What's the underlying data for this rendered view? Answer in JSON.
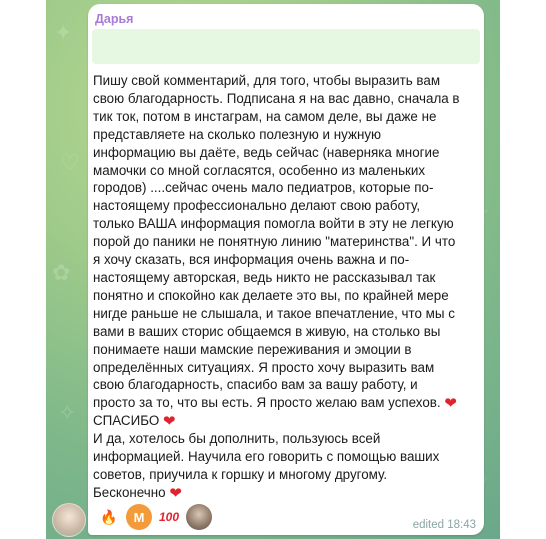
{
  "chat": {
    "background_color": "#9cc98a"
  },
  "message": {
    "sender": "Дарья",
    "sender_color": "#a77bd6",
    "lines": [
      "Пишу свой комментарий, для того, чтобы выразить вам",
      "свою благодарность. Подписана я на вас давно, сначала в",
      "тик ток, потом в инстаграм, на самом деле, вы даже не",
      "представляете на сколько полезную и нужную",
      "информацию вы даёте, ведь сейчас (наверняка многие",
      "мамочки со мной согласятся, особенно из маленьких",
      "городов) ....сейчас очень мало педиатров, которые  по-",
      "настоящему  профессионально делают свою работу,",
      "только ВАША информация помогла войти в эту не легкую",
      "порой до паники не понятную линию \"материнства\". И что",
      "я хочу сказать, вся информация очень важна и по-",
      "настоящему  авторская, ведь никто не рассказывал так",
      "понятно и спокойно как делаете это вы, по крайней мере",
      "нигде раньше не слышала, и такое впечатление, что мы с",
      "вами в ваших сторис общаемся в живую, на столько вы",
      "понимаете наши мамские переживания и эмоции в",
      "определённых ситуациях. Я просто хочу выразить вам",
      "свою благодарность, спасибо вам за вашу работу, и",
      "просто за то, что вы есть. Я просто желаю вам успехов."
    ],
    "line_spasibo": "СПАСИБО",
    "lines2": [
      "И да, хотелось бы дополнить, пользуюсь всей",
      "информацией. Научила его говорить с помощью ваших",
      "советов, приучила к горшку и многому другому."
    ],
    "line_end": "Бесконечно",
    "heart": "❤",
    "status": "edited 18:43"
  },
  "reactions": [
    {
      "name": "fire",
      "glyph": "🔥"
    },
    {
      "name": "m",
      "glyph": "M"
    },
    {
      "name": "hundred",
      "glyph": "100"
    },
    {
      "name": "user-avatar",
      "glyph": ""
    }
  ]
}
